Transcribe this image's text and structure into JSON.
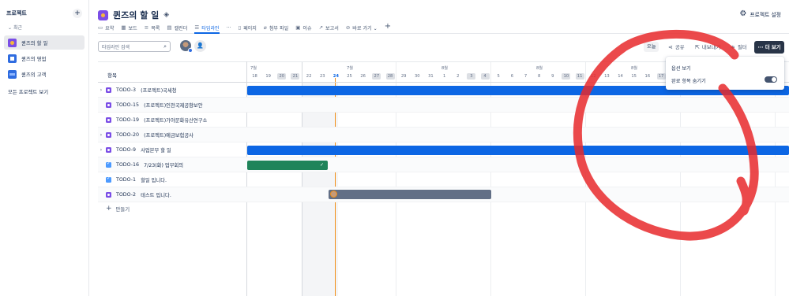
{
  "sidebar": {
    "heading": "프로젝트",
    "add_label": "+",
    "recent_label": "최근",
    "items": [
      {
        "label": "퀸즈의 할 일"
      },
      {
        "label": "퀸즈의 영업"
      },
      {
        "label": "퀸즈의 고객"
      }
    ],
    "all_projects": "모든 프로젝트 보기"
  },
  "header": {
    "title": "퀸즈의 할 일",
    "settings_label": "프로젝트 설정"
  },
  "tabs": [
    {
      "icon": "▭",
      "label": "요약"
    },
    {
      "icon": "▦",
      "label": "보드"
    },
    {
      "icon": "≡",
      "label": "목록"
    },
    {
      "icon": "▤",
      "label": "캘린더"
    },
    {
      "icon": "☰",
      "label": "타임라인"
    },
    {
      "icon": "···",
      "label": ""
    },
    {
      "icon": "▯",
      "label": "페이지"
    },
    {
      "icon": "⌀",
      "label": "첨부 파일"
    },
    {
      "icon": "▣",
      "label": "이슈"
    },
    {
      "icon": "↗",
      "label": "보고서"
    },
    {
      "icon": "⊘",
      "label": "바로 가기 ⌄"
    }
  ],
  "tab_add": "+",
  "toolbar": {
    "search_placeholder": "타임라인 검색",
    "today_label": "오늘",
    "share_label": "공유",
    "export_label": "내보내기",
    "filter_label": "필터",
    "more_label": "··· 더 보기"
  },
  "timeline": {
    "column_title": "항목",
    "months": [
      {
        "label": "7월"
      },
      {
        "label": "7월"
      },
      {
        "label": "8월"
      },
      {
        "label": "8월"
      },
      {
        "label": "8월"
      }
    ],
    "days": [
      "18",
      "19",
      "20",
      "21",
      "22",
      "23",
      "24",
      "25",
      "26",
      "27",
      "28",
      "29",
      "30",
      "31",
      "1",
      "2",
      "3",
      "4",
      "5",
      "6",
      "7",
      "8",
      "9",
      "10",
      "11",
      "12",
      "13",
      "14",
      "15",
      "16",
      "17"
    ],
    "weekend_days": [
      "20",
      "21",
      "27",
      "28",
      "3",
      "4",
      "10",
      "11",
      "17"
    ],
    "today_day": "24",
    "rows": [
      {
        "key": "TODO-3",
        "summary": "(프로젝트)국세청",
        "expandable": true
      },
      {
        "key": "TODO-15",
        "summary": "(프로젝트)인천국제공항보안",
        "expandable": false
      },
      {
        "key": "TODO-19",
        "summary": "(프로젝트)가야문화유산연구소",
        "expandable": false
      },
      {
        "key": "TODO-20",
        "summary": "(프로젝트)예금보험공사",
        "expandable": true
      },
      {
        "key": "TODO-9",
        "summary": "사업본부 할 일",
        "expandable": true
      },
      {
        "key": "TODO-16",
        "summary": "7/23(화) 업무회의",
        "expandable": false
      },
      {
        "key": "TODO-1",
        "summary": "할일 입니다.",
        "expandable": false
      },
      {
        "key": "TODO-2",
        "summary": "테스트 입니다.",
        "expandable": false
      }
    ],
    "create_label": "만들기",
    "done_check": "✓"
  },
  "dropdown": {
    "option_view": "옵션 보기",
    "hide_done": "완료 항목 숨기기"
  },
  "colors": {
    "accent": "#0c66e4",
    "bar_blue": "#0c66e4",
    "bar_green": "#1f845a",
    "bar_gray": "#626f86",
    "today_line": "#f18d13",
    "annotation": "#e8292b"
  }
}
